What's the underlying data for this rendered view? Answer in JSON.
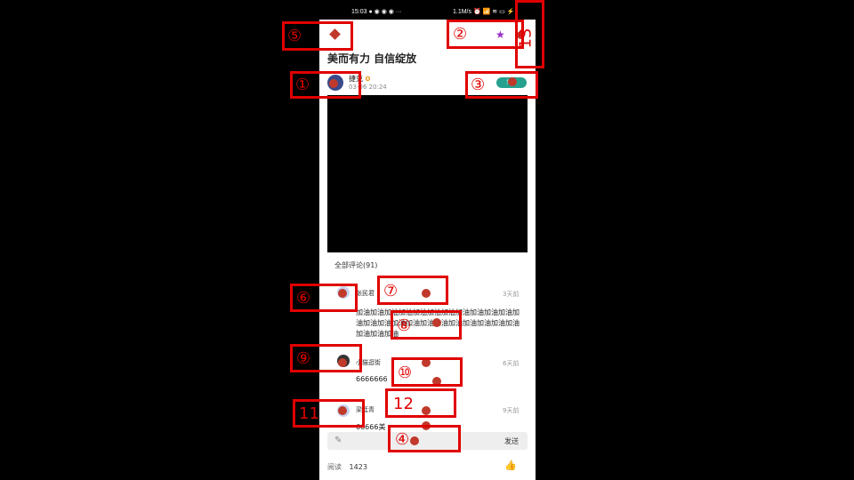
{
  "statusbar": {
    "time": "15:03 ● ◉ ◉ ◉ ···",
    "right": "1.1M/s ⏰ 📶 ≋ ▭ ⚡"
  },
  "post": {
    "title": "美而有力 自信绽放",
    "author": "捷克",
    "date": "03-06 20:24",
    "follow_label": "关注"
  },
  "comments_header": "全部评论(91)",
  "comments": [
    {
      "name": "张民君",
      "time": "3天前",
      "text": "加油加油加油加油加油加油加油加油加油加油加油加油加油加油加油加油加油加油加油加油加油加油加油加油加油加油"
    },
    {
      "name": "小猫逛街",
      "time": "6天前",
      "text": "6666666"
    },
    {
      "name": "梁廷青",
      "time": "9天前",
      "text": "66666美"
    }
  ],
  "input": {
    "send_label": "发送"
  },
  "footer": {
    "read_label": "阅读",
    "read_count": "1423"
  },
  "annotations": [
    "①",
    "②",
    "③",
    "④",
    "⑤",
    "⑥",
    "⑦",
    "⑧",
    "⑨",
    "⑩",
    "11",
    "12",
    "13"
  ],
  "colors": {
    "accent": "#25a18e",
    "marker": "#e00000",
    "dot": "#c0392b"
  },
  "icons": [
    "back-icon",
    "star-icon",
    "share-icon",
    "verified-icon",
    "edit-icon",
    "like-icon"
  ]
}
